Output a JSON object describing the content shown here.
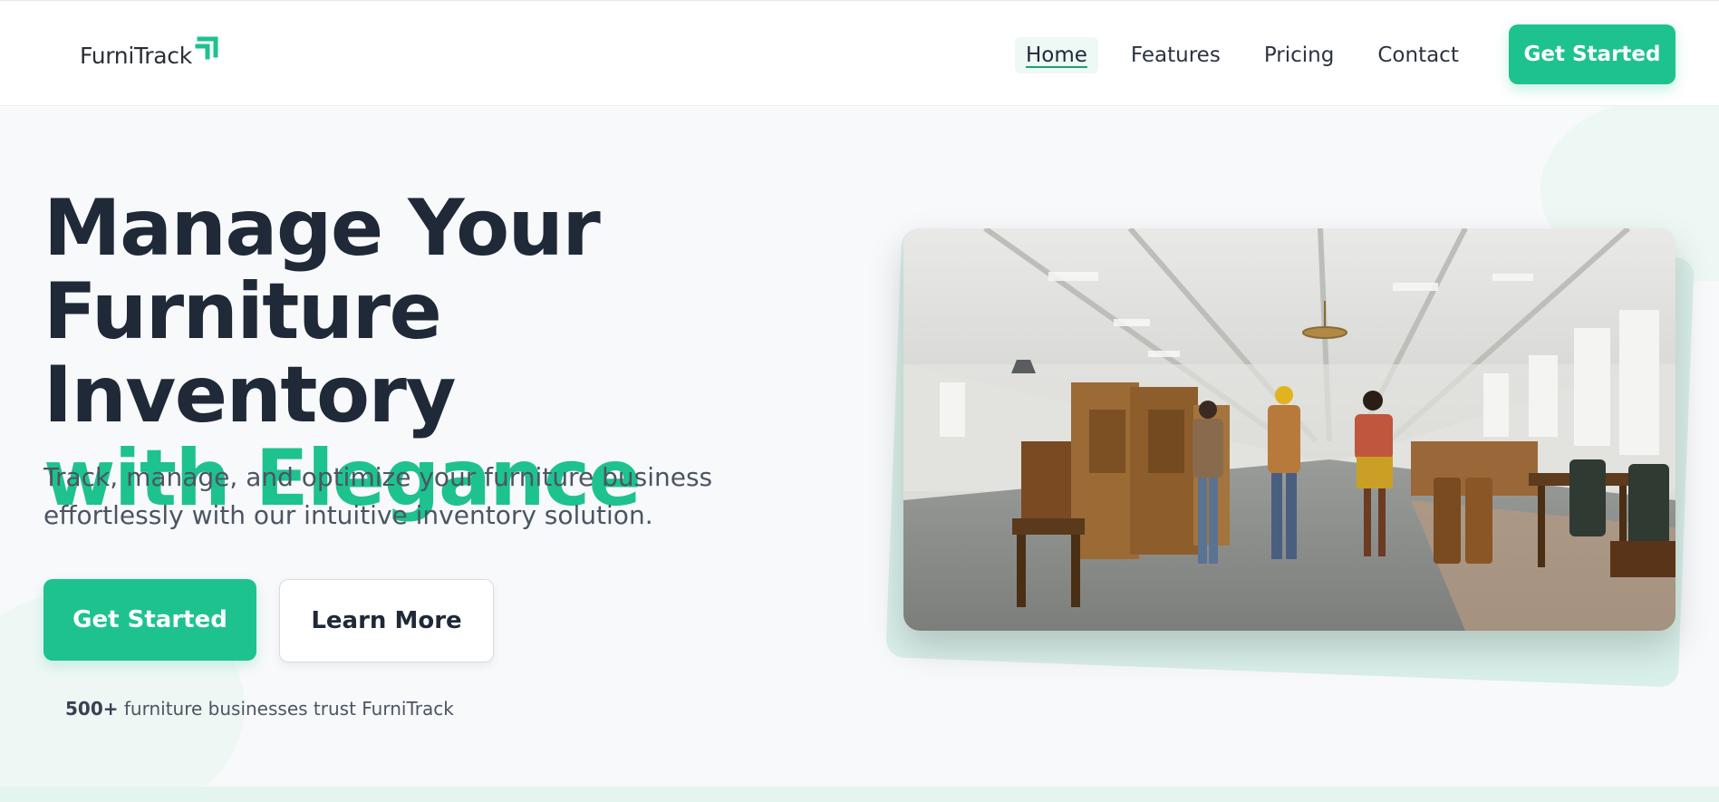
{
  "header": {
    "logo_text": "FurniTrack",
    "nav": [
      {
        "label": "Home",
        "active": true
      },
      {
        "label": "Features"
      },
      {
        "label": "Pricing"
      },
      {
        "label": "Contact"
      }
    ],
    "cta_label": "Get Started"
  },
  "hero": {
    "title_line1": "Manage Your",
    "title_line2": "Furniture Inventory",
    "title_accent": "with Elegance",
    "subtitle": "Track, manage, and optimize your furniture business effortlessly with our intuitive inventory solution.",
    "primary_label": "Get Started",
    "secondary_label": "Learn More",
    "trust_count": "500+",
    "trust_text": "furniture businesses trust FurniTrack"
  },
  "image": {
    "icon": "furniture-showroom-photo"
  },
  "colors": {
    "accent": "#1ec28e",
    "text": "#1f2937",
    "muted": "#4b5563"
  }
}
